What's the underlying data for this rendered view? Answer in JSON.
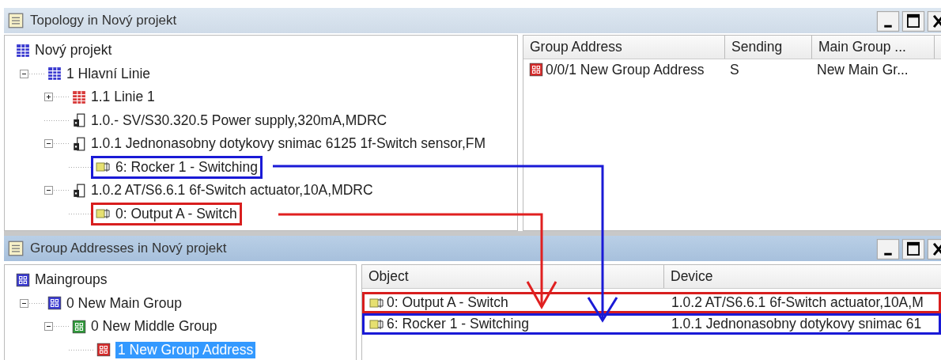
{
  "topology_window": {
    "title": "Topology in Nový projekt",
    "tree": [
      {
        "label": "Nový projekt",
        "kind": "network",
        "selected": false,
        "children": [
          {
            "label": "1 Hlavní Linie",
            "kind": "network",
            "selected": false,
            "expanded": true,
            "children": [
              {
                "label": "1.1 Linie 1",
                "kind": "line",
                "selected": false,
                "expanded": false
              },
              {
                "label": "1.0.- SV/S30.320.5 Power supply,320mA,MDRC",
                "kind": "device",
                "selected": false
              },
              {
                "label": "1.0.1 Jednonasobny dotykovy snimac 6125 1f-Switch sensor,FM",
                "kind": "device",
                "selected": false,
                "expanded": true,
                "children": [
                  {
                    "label": "6: Rocker 1 - Switching",
                    "kind": "object",
                    "selected": false,
                    "color": "#1a1ad6"
                  }
                ]
              },
              {
                "label": "1.0.2 AT/S6.6.1 6f-Switch actuator,10A,MDRC",
                "kind": "device",
                "selected": false,
                "expanded": true,
                "children": [
                  {
                    "label": "0: Output A - Switch",
                    "kind": "object",
                    "selected": false,
                    "color": "#d81e1e"
                  }
                ]
              }
            ]
          }
        ]
      }
    ],
    "table": {
      "columns": [
        "Group Address",
        "Sending",
        "Main Group ..."
      ],
      "rows": [
        {
          "kind": "address",
          "cells": [
            "0/0/1 New Group Address",
            "S",
            "New Main Gr..."
          ]
        }
      ]
    }
  },
  "group_addresses_window": {
    "title": "Group Addresses in Nový projekt",
    "tree": [
      {
        "label": "Maingroups",
        "kind": "main",
        "selected": false,
        "children": [
          {
            "label": "0 New Main Group",
            "kind": "main",
            "selected": false,
            "expanded": true,
            "children": [
              {
                "label": "0 New Middle Group",
                "kind": "middle",
                "selected": false,
                "expanded": true,
                "children": [
                  {
                    "label": "1 New Group Address",
                    "kind": "address",
                    "selected": true
                  }
                ]
              }
            ]
          }
        ]
      }
    ],
    "table": {
      "columns": [
        "Object",
        "Device"
      ],
      "rows": [
        {
          "kind": "object",
          "color": "#d81e1e",
          "cells": [
            "0: Output A - Switch",
            "1.0.2 AT/S6.6.1 6f-Switch actuator,10A,M"
          ]
        },
        {
          "kind": "object",
          "color": "#1a1ad6",
          "cells": [
            "6: Rocker 1 - Switching",
            "1.0.1 Jednonasobny dotykovy snimac 61"
          ]
        }
      ]
    }
  },
  "arrows": [
    {
      "color": "#e02020"
    },
    {
      "color": "#1a1ad6"
    }
  ]
}
